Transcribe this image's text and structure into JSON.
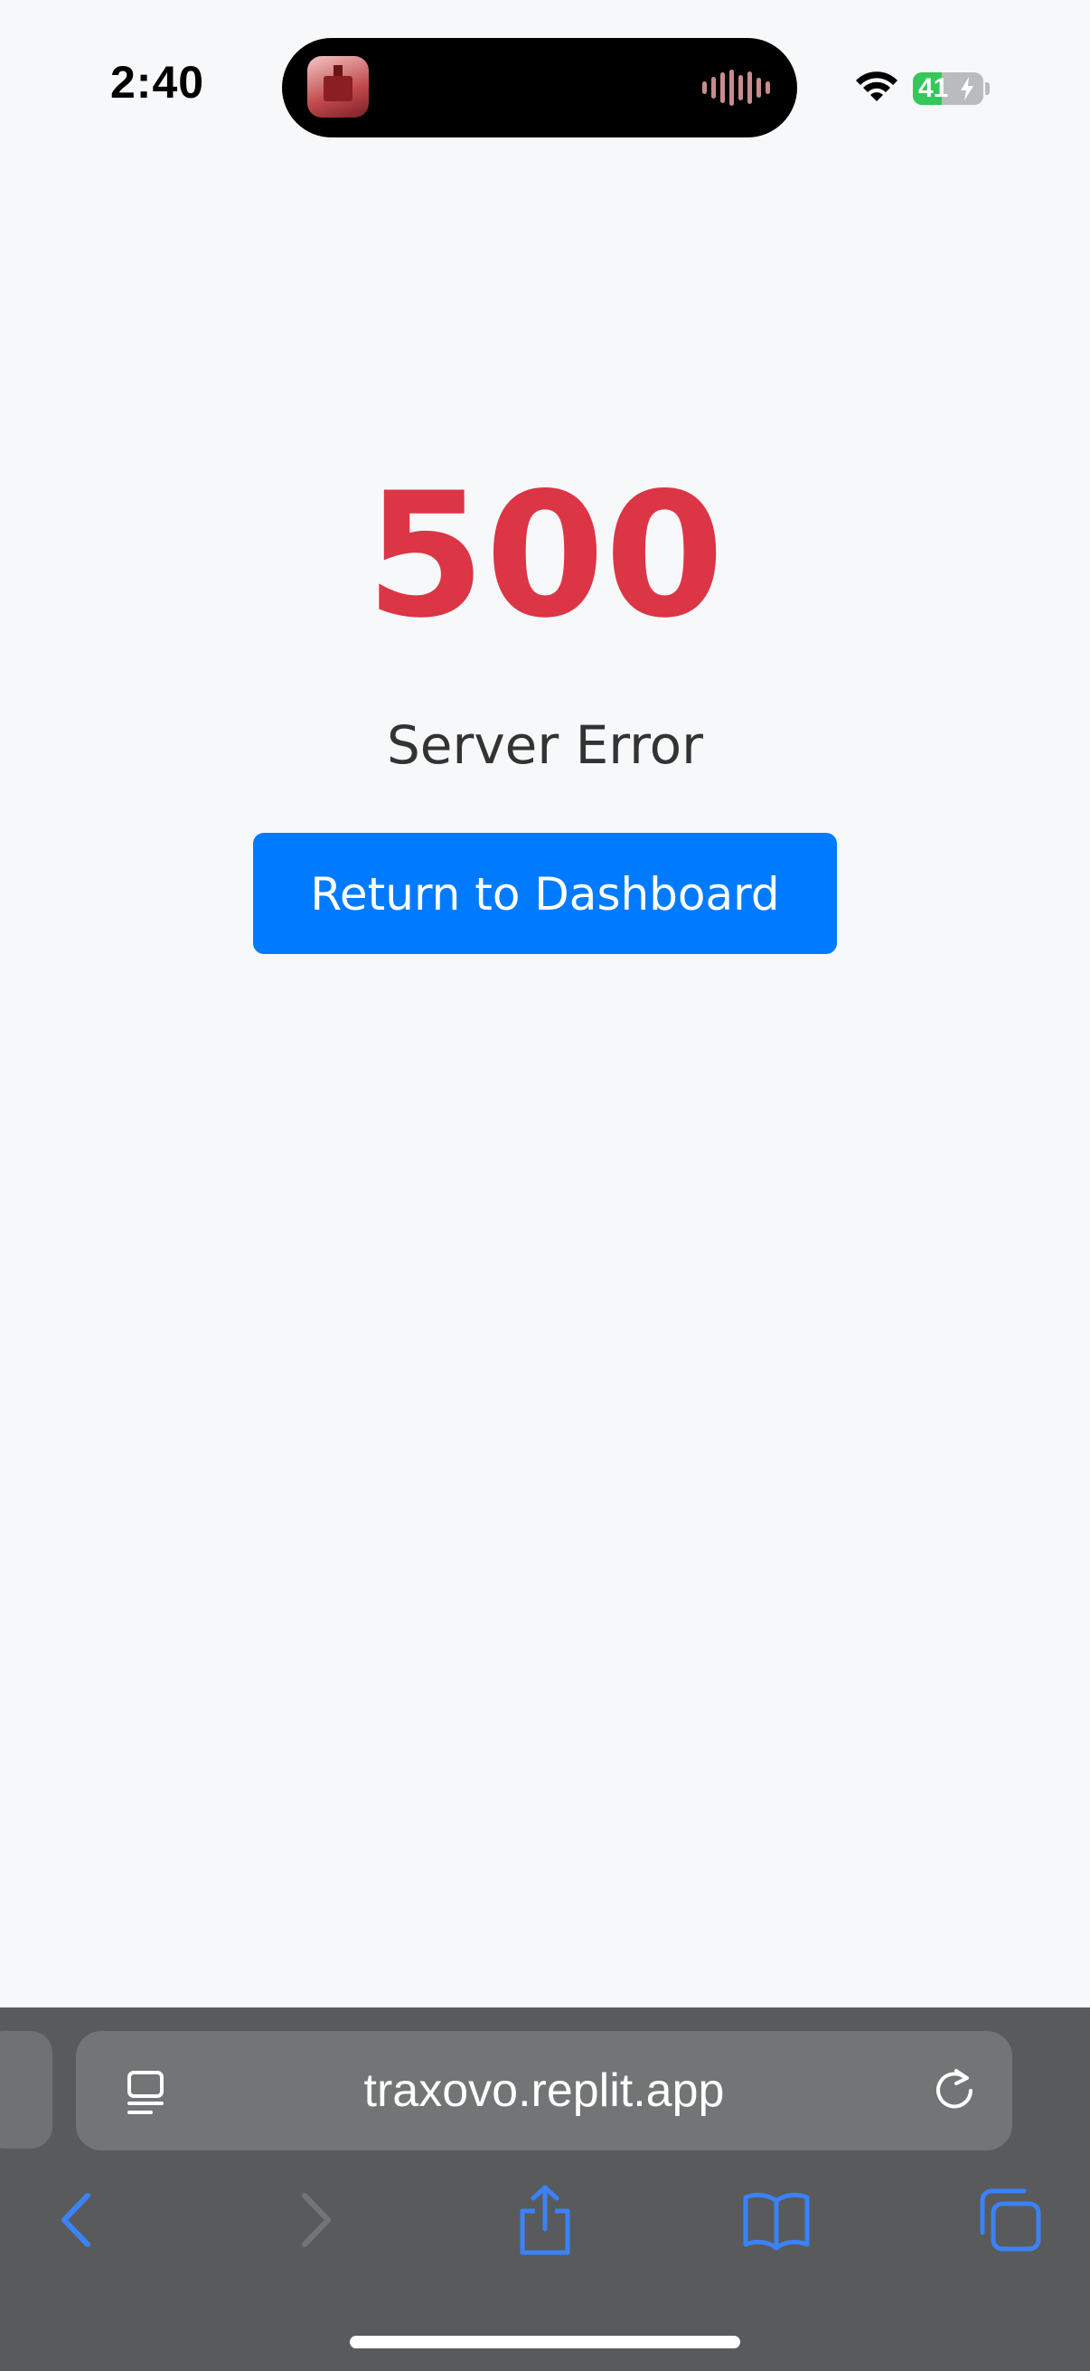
{
  "status_bar": {
    "time": "2:40",
    "battery_percent": "41",
    "battery_level": 0.41,
    "charging": true,
    "icons": [
      "wifi-icon",
      "battery-icon",
      "charging-bolt-icon",
      "audio-waveform-icon"
    ]
  },
  "error": {
    "code": "500",
    "message": "Server Error",
    "button_label": "Return to Dashboard"
  },
  "browser": {
    "url": "traxovo.replit.app",
    "icons": [
      "reader-icon",
      "reload-icon",
      "back-icon",
      "forward-icon",
      "share-icon",
      "bookmarks-icon",
      "tabs-icon"
    ]
  },
  "colors": {
    "background": "#f7f8fa",
    "error_red": "#dc3545",
    "button_blue": "#007bff",
    "toolbar_gray": "#585a5c",
    "accent_blue": "#3b82f6"
  }
}
